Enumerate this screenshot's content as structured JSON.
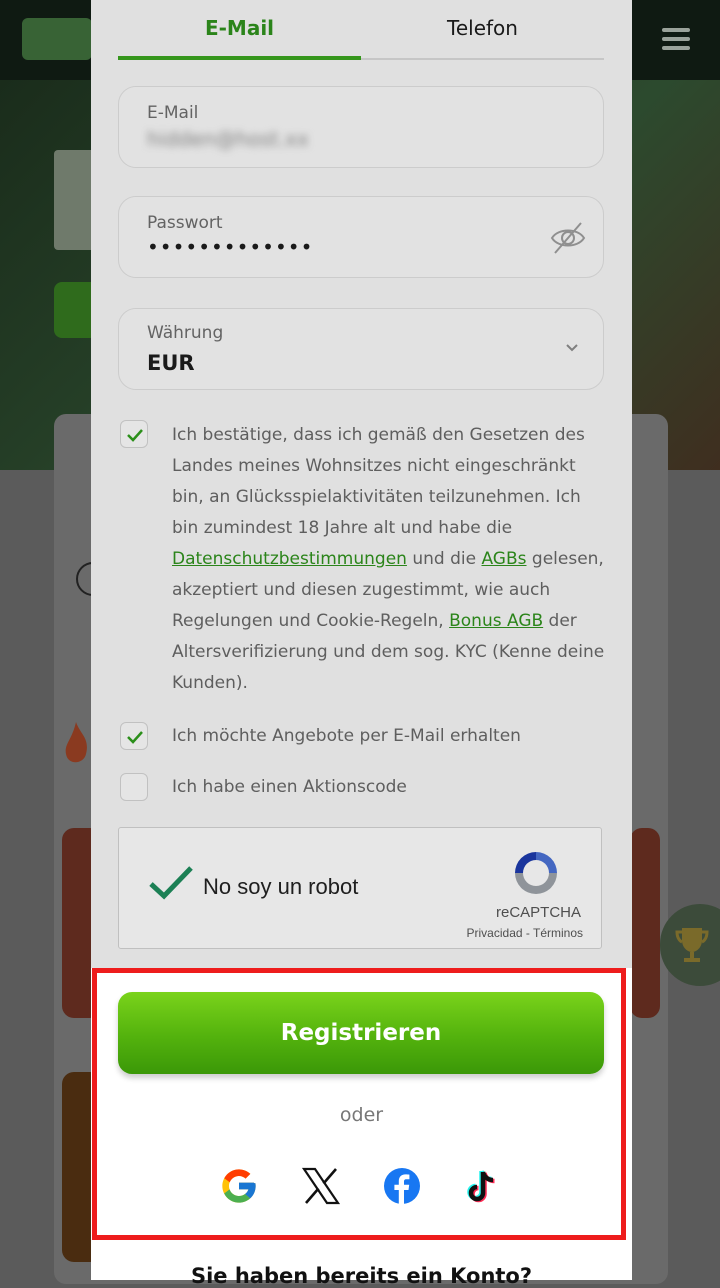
{
  "tabs": {
    "email": "E-Mail",
    "phone": "Telefon"
  },
  "form": {
    "email": {
      "label": "E-Mail",
      "value": "hidden@host.xx"
    },
    "password": {
      "label": "Passwort",
      "value": "•••••••••••••"
    },
    "currency": {
      "label": "Währung",
      "value": "EUR"
    }
  },
  "consent": {
    "part1": "Ich bestätige, dass ich gemäß den Gesetzen des Landes meines Wohnsitzes nicht eingeschränkt bin, an Glücksspielaktivitäten teilzunehmen. Ich bin zumindest 18 Jahre alt und habe die ",
    "link_privacy": "Datenschutzbestimmungen",
    "part2": " und die ",
    "link_terms": "AGBs",
    "part3": " gelesen, akzeptiert und diesen zugestimmt, wie auch Regelungen und Cookie-Regeln, ",
    "link_bonus": "Bonus AGB",
    "part4": " der Altersverifizierung und dem sog. KYC (Kenne deine Kunden)."
  },
  "offers_label": "Ich möchte Angebote per E-Mail erhalten",
  "promo_label": "Ich habe einen Aktionscode",
  "recaptcha": {
    "label": "No soy un robot",
    "brand": "reCAPTCHA",
    "links": "Privacidad - Términos"
  },
  "register_label": "Registrieren",
  "or_label": "oder",
  "social": [
    "google-icon",
    "x-icon",
    "facebook-icon",
    "tiktok-icon"
  ],
  "login_prompt": "Sie haben bereits ein Konto?",
  "colors": {
    "accent": "#3aa21f",
    "highlight": "#ee1c1c"
  }
}
